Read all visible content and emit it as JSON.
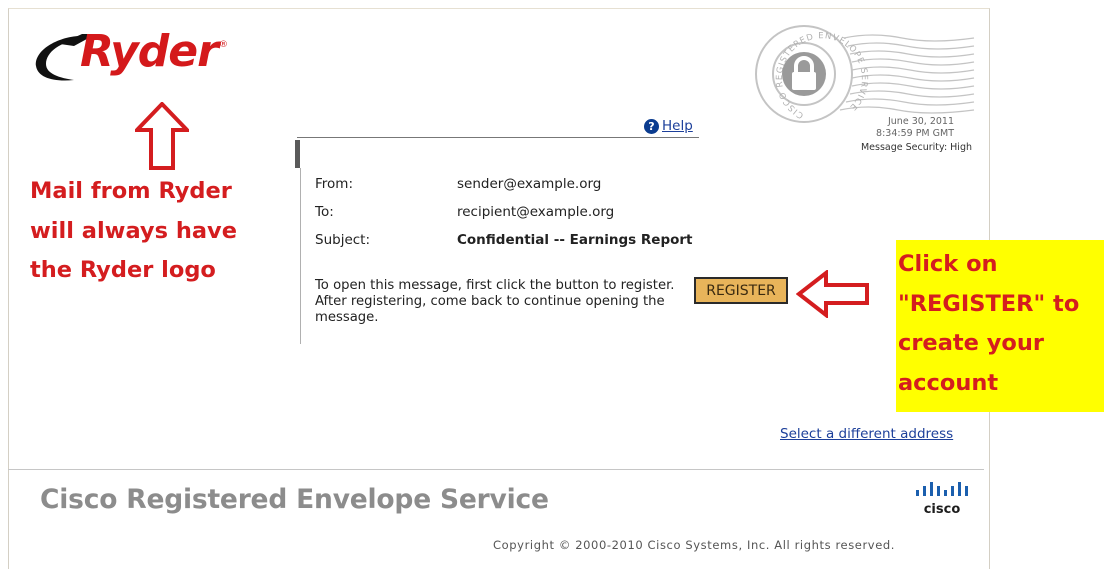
{
  "brand": {
    "logo_text": "Ryder",
    "registered_mark": "®",
    "colors": {
      "ryder_red": "#d4191b",
      "annotation_red": "#d41d1f",
      "highlight_yellow": "#ffff00",
      "register_button": "#e8b45a",
      "link_blue": "#1c3f9a"
    }
  },
  "annotations": {
    "left_note": "Mail from Ryder will always have the Ryder logo",
    "right_note": "Click on \"REGISTER\" to create your account",
    "up_arrow_icon": "up-arrow-icon",
    "left_arrow_icon": "left-arrow-icon"
  },
  "stamp": {
    "ring_text": "CISCO REGISTERED ENVELOPE SERVICE",
    "date": "June 30, 2011",
    "time": "8:34:59 PM GMT",
    "security": "Message Security:  High",
    "icon": "lock-icon"
  },
  "help": {
    "label": "Help",
    "icon": "help-icon"
  },
  "message": {
    "from_label": "From:",
    "from_value": "sender@example.org",
    "to_label": "To:",
    "to_value": "recipient@example.org",
    "subject_label": "Subject:",
    "subject_value": "Confidential -- Earnings Report",
    "instructions": "To open this message, first click the button to register. After registering, come back to continue opening the message.",
    "register_label": "REGISTER"
  },
  "links": {
    "select_address": "Select a different address"
  },
  "footer": {
    "title": "Cisco Registered Envelope Service",
    "cisco_word": "cisco",
    "copyright": "Copyright © 2000-2010 Cisco Systems, Inc. All rights reserved."
  }
}
